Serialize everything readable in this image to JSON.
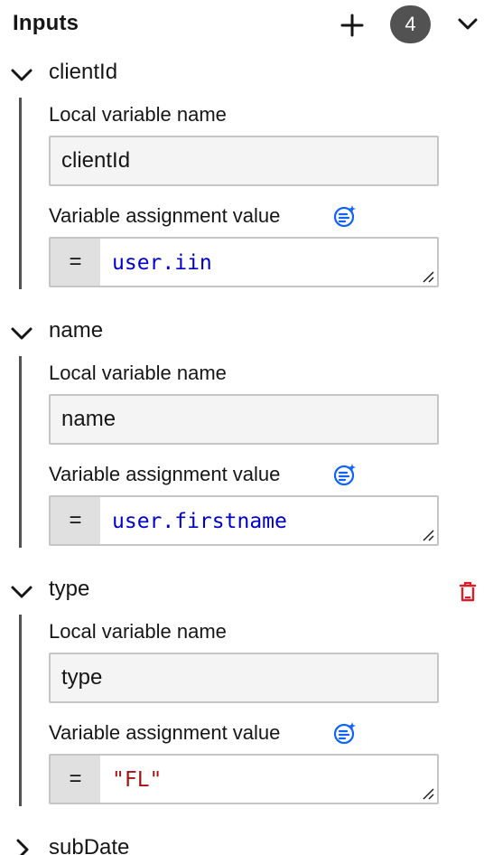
{
  "header": {
    "title": "Inputs",
    "count": "4"
  },
  "inputs": [
    {
      "title": "clientId",
      "name_label": "Local variable name",
      "name_value": "clientId",
      "value_label": "Variable assignment value",
      "operator": "=",
      "value": "user.iin",
      "value_color": "#0000cd",
      "expanded": true
    },
    {
      "title": "name",
      "name_label": "Local variable name",
      "name_value": "name",
      "value_label": "Variable assignment value",
      "operator": "=",
      "value": "user.firstname",
      "value_color": "#0000cd",
      "expanded": true
    },
    {
      "title": "type",
      "name_label": "Local variable name",
      "name_value": "type",
      "value_label": "Variable assignment value",
      "operator": "=",
      "value": "\"FL\"",
      "value_color": "#a31515",
      "expanded": true
    },
    {
      "title": "subDate",
      "expanded": false
    }
  ],
  "colors": {
    "delete": "#da1e28",
    "ai_icon": "#0f62fe",
    "badge": "#525252"
  },
  "icons": {
    "add": "plus-icon",
    "collapse": "chevron-down-icon",
    "expand": "chevron-right-icon",
    "ai": "ai-assist-icon",
    "delete": "trash-icon"
  }
}
